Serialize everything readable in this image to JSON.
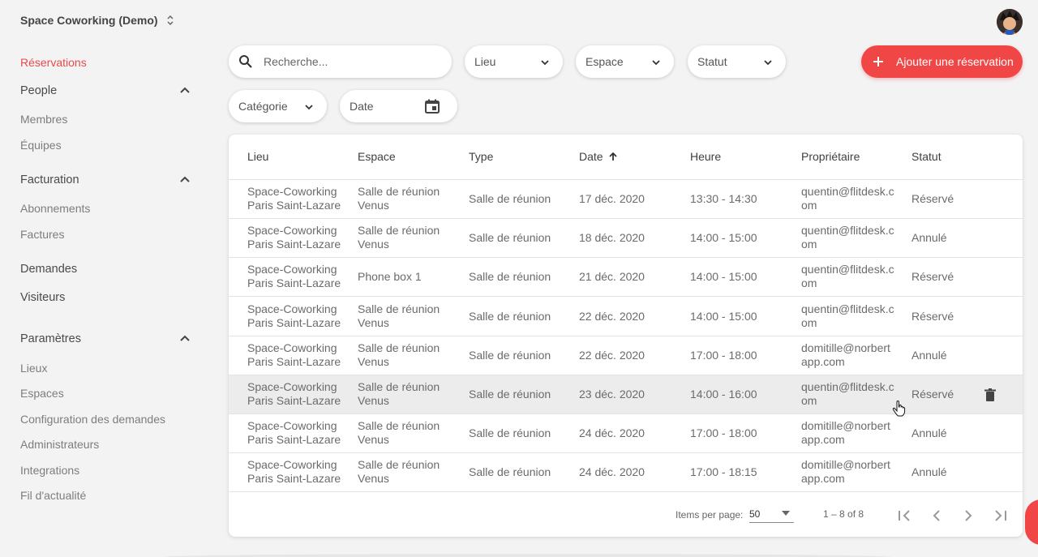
{
  "workspace": {
    "name": "Space Coworking (Demo)"
  },
  "sidebar": {
    "items": [
      {
        "label": "Réservations",
        "kind": "active"
      },
      {
        "label": "People",
        "kind": "section",
        "expanded": true
      },
      {
        "label": "Membres",
        "kind": "sub"
      },
      {
        "label": "Équipes",
        "kind": "sub"
      },
      {
        "label": "Facturation",
        "kind": "section",
        "expanded": true
      },
      {
        "label": "Abonnements",
        "kind": "sub"
      },
      {
        "label": "Factures",
        "kind": "sub"
      },
      {
        "label": "Demandes",
        "kind": "section"
      },
      {
        "label": "Visiteurs",
        "kind": "section"
      },
      {
        "label": "Paramètres",
        "kind": "section",
        "expanded": true
      },
      {
        "label": "Lieux",
        "kind": "sub"
      },
      {
        "label": "Espaces",
        "kind": "sub"
      },
      {
        "label": "Configuration des demandes",
        "kind": "sub"
      },
      {
        "label": "Administrateurs",
        "kind": "sub"
      },
      {
        "label": "Integrations",
        "kind": "sub"
      },
      {
        "label": "Fil d'actualité",
        "kind": "sub"
      }
    ]
  },
  "filters": {
    "search_placeholder": "Recherche...",
    "lieu": "Lieu",
    "espace": "Espace",
    "statut": "Statut",
    "categorie": "Catégorie",
    "date": "Date"
  },
  "add_button": {
    "label": "Ajouter une réservation",
    "icon": "plus-icon"
  },
  "table": {
    "headers": [
      "Lieu",
      "Espace",
      "Type",
      "Date",
      "Heure",
      "Propriétaire",
      "Statut"
    ],
    "sort": {
      "column": "Date",
      "direction": "asc"
    },
    "rows": [
      {
        "lieu": [
          "Space-Coworking",
          "Paris Saint-Lazare"
        ],
        "espace": [
          "Salle de réunion",
          "Venus"
        ],
        "type": "Salle de réunion",
        "date": "17 déc. 2020",
        "heure": "13:30 - 14:30",
        "owner": [
          "quentin@flitdesk.c",
          "om"
        ],
        "statut": "Réservé"
      },
      {
        "lieu": [
          "Space-Coworking",
          "Paris Saint-Lazare"
        ],
        "espace": [
          "Salle de réunion",
          "Venus"
        ],
        "type": "Salle de réunion",
        "date": "18 déc. 2020",
        "heure": "14:00 - 15:00",
        "owner": [
          "quentin@flitdesk.c",
          "om"
        ],
        "statut": "Annulé"
      },
      {
        "lieu": [
          "Space-Coworking",
          "Paris Saint-Lazare"
        ],
        "espace": [
          "Phone box 1"
        ],
        "type": "Salle de réunion",
        "date": "21 déc. 2020",
        "heure": "14:00 - 15:00",
        "owner": [
          "quentin@flitdesk.c",
          "om"
        ],
        "statut": "Réservé"
      },
      {
        "lieu": [
          "Space-Coworking",
          "Paris Saint-Lazare"
        ],
        "espace": [
          "Salle de réunion",
          "Venus"
        ],
        "type": "Salle de réunion",
        "date": "22 déc. 2020",
        "heure": "14:00 - 15:00",
        "owner": [
          "quentin@flitdesk.c",
          "om"
        ],
        "statut": "Réservé"
      },
      {
        "lieu": [
          "Space-Coworking",
          "Paris Saint-Lazare"
        ],
        "espace": [
          "Salle de réunion",
          "Venus"
        ],
        "type": "Salle de réunion",
        "date": "22 déc. 2020",
        "heure": "17:00 - 18:00",
        "owner": [
          "domitille@norbert",
          "app.com"
        ],
        "statut": "Annulé"
      },
      {
        "lieu": [
          "Space-Coworking",
          "Paris Saint-Lazare"
        ],
        "espace": [
          "Salle de réunion",
          "Venus"
        ],
        "type": "Salle de réunion",
        "date": "23 déc. 2020",
        "heure": "14:00 - 16:00",
        "owner": [
          "quentin@flitdesk.c",
          "om"
        ],
        "statut": "Réservé",
        "hovered": true
      },
      {
        "lieu": [
          "Space-Coworking",
          "Paris Saint-Lazare"
        ],
        "espace": [
          "Salle de réunion",
          "Venus"
        ],
        "type": "Salle de réunion",
        "date": "24 déc. 2020",
        "heure": "17:00 - 18:00",
        "owner": [
          "domitille@norbert",
          "app.com"
        ],
        "statut": "Annulé"
      },
      {
        "lieu": [
          "Space-Coworking",
          "Paris Saint-Lazare"
        ],
        "espace": [
          "Salle de réunion",
          "Venus"
        ],
        "type": "Salle de réunion",
        "date": "24 déc. 2020",
        "heure": "17:00 - 18:15",
        "owner": [
          "domitille@norbert",
          "app.com"
        ],
        "statut": "Annulé"
      }
    ]
  },
  "pagination": {
    "items_per_page_label": "Items per page:",
    "page_size": "50",
    "range": "1 – 8 of 8"
  },
  "colors": {
    "accent": "#f04646",
    "active_nav": "#e84a4a",
    "background": "#f3f3f4"
  }
}
